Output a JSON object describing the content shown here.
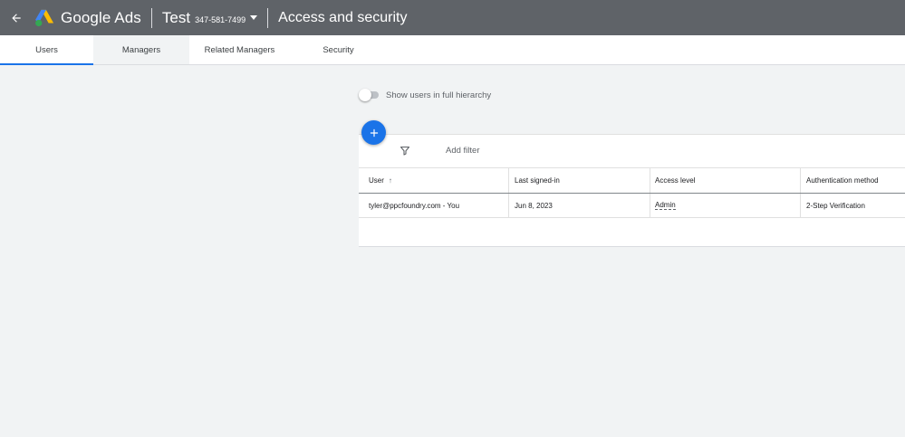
{
  "header": {
    "app_name": "Google Ads",
    "account_name": "Test",
    "account_id": "347-581-7499",
    "page_title": "Access and security",
    "background": "#5f6368"
  },
  "tabs": [
    {
      "label": "Users",
      "active": true
    },
    {
      "label": "Managers",
      "active": false
    },
    {
      "label": "Related Managers",
      "active": false
    },
    {
      "label": "Security",
      "active": false
    }
  ],
  "toggle": {
    "label": "Show users in full hierarchy",
    "on": false
  },
  "filter": {
    "add_filter_label": "Add filter"
  },
  "table": {
    "columns": [
      "User",
      "Last signed-in",
      "Access level",
      "Authentication method"
    ],
    "rows": [
      [
        "tyler@ppcfoundry.com - You",
        "Jun 8, 2023",
        "Admin",
        "2-Step Verification"
      ]
    ]
  },
  "colors": {
    "accent": "#1a73e8",
    "page_bg": "#f1f3f4"
  }
}
